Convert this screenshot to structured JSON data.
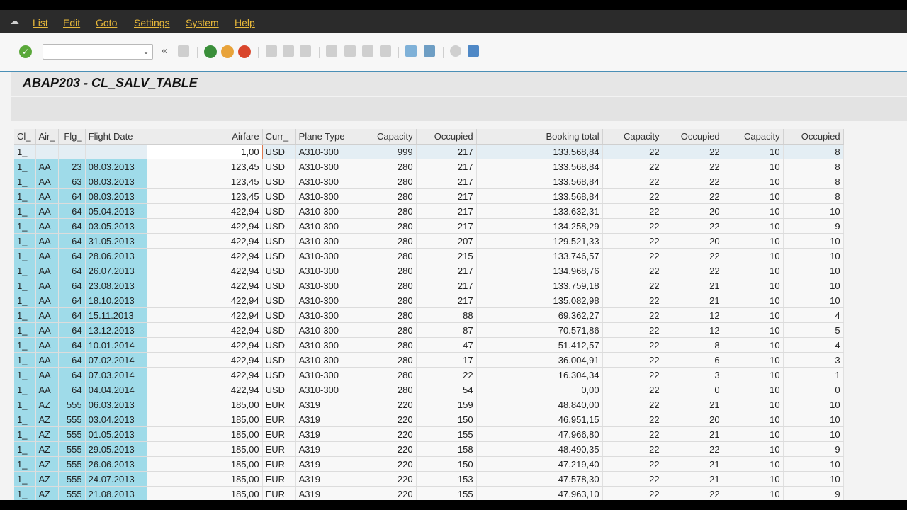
{
  "menu": [
    "List",
    "Edit",
    "Goto",
    "Settings",
    "System",
    "Help"
  ],
  "toolbar": {
    "command_value": "",
    "icons": [
      "enter-check",
      "back",
      "exit",
      "cancel",
      "print",
      "find",
      "find-next",
      "first-page",
      "prev-page",
      "next-page",
      "last-page",
      "create-session",
      "shortcut",
      "help",
      "customize-layout"
    ],
    "accent": "#4a8fb6"
  },
  "title": "ABAP203 - CL_SALV_TABLE",
  "columns": [
    "Cl_",
    "Air_",
    "Flg_",
    "Flight Date",
    "Airfare",
    "Curr_",
    "Plane Type",
    "Capacity",
    "Occupied",
    "Booking total",
    "Capacity",
    "Occupied",
    "Capacity",
    "Occupied"
  ],
  "rows": [
    [
      "1_",
      "",
      "",
      "",
      "1,00",
      "USD",
      "A310-300",
      "999",
      "217",
      "133.568,84",
      "22",
      "22",
      "10",
      "8"
    ],
    [
      "1_",
      "AA",
      "23",
      "08.03.2013",
      "123,45",
      "USD",
      "A310-300",
      "280",
      "217",
      "133.568,84",
      "22",
      "22",
      "10",
      "8"
    ],
    [
      "1_",
      "AA",
      "63",
      "08.03.2013",
      "123,45",
      "USD",
      "A310-300",
      "280",
      "217",
      "133.568,84",
      "22",
      "22",
      "10",
      "8"
    ],
    [
      "1_",
      "AA",
      "64",
      "08.03.2013",
      "123,45",
      "USD",
      "A310-300",
      "280",
      "217",
      "133.568,84",
      "22",
      "22",
      "10",
      "8"
    ],
    [
      "1_",
      "AA",
      "64",
      "05.04.2013",
      "422,94",
      "USD",
      "A310-300",
      "280",
      "217",
      "133.632,31",
      "22",
      "20",
      "10",
      "10"
    ],
    [
      "1_",
      "AA",
      "64",
      "03.05.2013",
      "422,94",
      "USD",
      "A310-300",
      "280",
      "217",
      "134.258,29",
      "22",
      "22",
      "10",
      "9"
    ],
    [
      "1_",
      "AA",
      "64",
      "31.05.2013",
      "422,94",
      "USD",
      "A310-300",
      "280",
      "207",
      "129.521,33",
      "22",
      "20",
      "10",
      "10"
    ],
    [
      "1_",
      "AA",
      "64",
      "28.06.2013",
      "422,94",
      "USD",
      "A310-300",
      "280",
      "215",
      "133.746,57",
      "22",
      "22",
      "10",
      "10"
    ],
    [
      "1_",
      "AA",
      "64",
      "26.07.2013",
      "422,94",
      "USD",
      "A310-300",
      "280",
      "217",
      "134.968,76",
      "22",
      "22",
      "10",
      "10"
    ],
    [
      "1_",
      "AA",
      "64",
      "23.08.2013",
      "422,94",
      "USD",
      "A310-300",
      "280",
      "217",
      "133.759,18",
      "22",
      "21",
      "10",
      "10"
    ],
    [
      "1_",
      "AA",
      "64",
      "18.10.2013",
      "422,94",
      "USD",
      "A310-300",
      "280",
      "217",
      "135.082,98",
      "22",
      "21",
      "10",
      "10"
    ],
    [
      "1_",
      "AA",
      "64",
      "15.11.2013",
      "422,94",
      "USD",
      "A310-300",
      "280",
      "88",
      "69.362,27",
      "22",
      "12",
      "10",
      "4"
    ],
    [
      "1_",
      "AA",
      "64",
      "13.12.2013",
      "422,94",
      "USD",
      "A310-300",
      "280",
      "87",
      "70.571,86",
      "22",
      "12",
      "10",
      "5"
    ],
    [
      "1_",
      "AA",
      "64",
      "10.01.2014",
      "422,94",
      "USD",
      "A310-300",
      "280",
      "47",
      "51.412,57",
      "22",
      "8",
      "10",
      "4"
    ],
    [
      "1_",
      "AA",
      "64",
      "07.02.2014",
      "422,94",
      "USD",
      "A310-300",
      "280",
      "17",
      "36.004,91",
      "22",
      "6",
      "10",
      "3"
    ],
    [
      "1_",
      "AA",
      "64",
      "07.03.2014",
      "422,94",
      "USD",
      "A310-300",
      "280",
      "22",
      "16.304,34",
      "22",
      "3",
      "10",
      "1"
    ],
    [
      "1_",
      "AA",
      "64",
      "04.04.2014",
      "422,94",
      "USD",
      "A310-300",
      "280",
      "54",
      "0,00",
      "22",
      "0",
      "10",
      "0"
    ],
    [
      "1_",
      "AZ",
      "555",
      "06.03.2013",
      "185,00",
      "EUR",
      "A319",
      "220",
      "159",
      "48.840,00",
      "22",
      "21",
      "10",
      "10"
    ],
    [
      "1_",
      "AZ",
      "555",
      "03.04.2013",
      "185,00",
      "EUR",
      "A319",
      "220",
      "150",
      "46.951,15",
      "22",
      "20",
      "10",
      "10"
    ],
    [
      "1_",
      "AZ",
      "555",
      "01.05.2013",
      "185,00",
      "EUR",
      "A319",
      "220",
      "155",
      "47.966,80",
      "22",
      "21",
      "10",
      "10"
    ],
    [
      "1_",
      "AZ",
      "555",
      "29.05.2013",
      "185,00",
      "EUR",
      "A319",
      "220",
      "158",
      "48.490,35",
      "22",
      "22",
      "10",
      "9"
    ],
    [
      "1_",
      "AZ",
      "555",
      "26.06.2013",
      "185,00",
      "EUR",
      "A319",
      "220",
      "150",
      "47.219,40",
      "22",
      "21",
      "10",
      "10"
    ],
    [
      "1_",
      "AZ",
      "555",
      "24.07.2013",
      "185,00",
      "EUR",
      "A319",
      "220",
      "153",
      "47.578,30",
      "22",
      "21",
      "10",
      "10"
    ],
    [
      "1_",
      "AZ",
      "555",
      "21.08.2013",
      "185,00",
      "EUR",
      "A319",
      "220",
      "155",
      "47.963,10",
      "22",
      "22",
      "10",
      "9"
    ]
  ]
}
